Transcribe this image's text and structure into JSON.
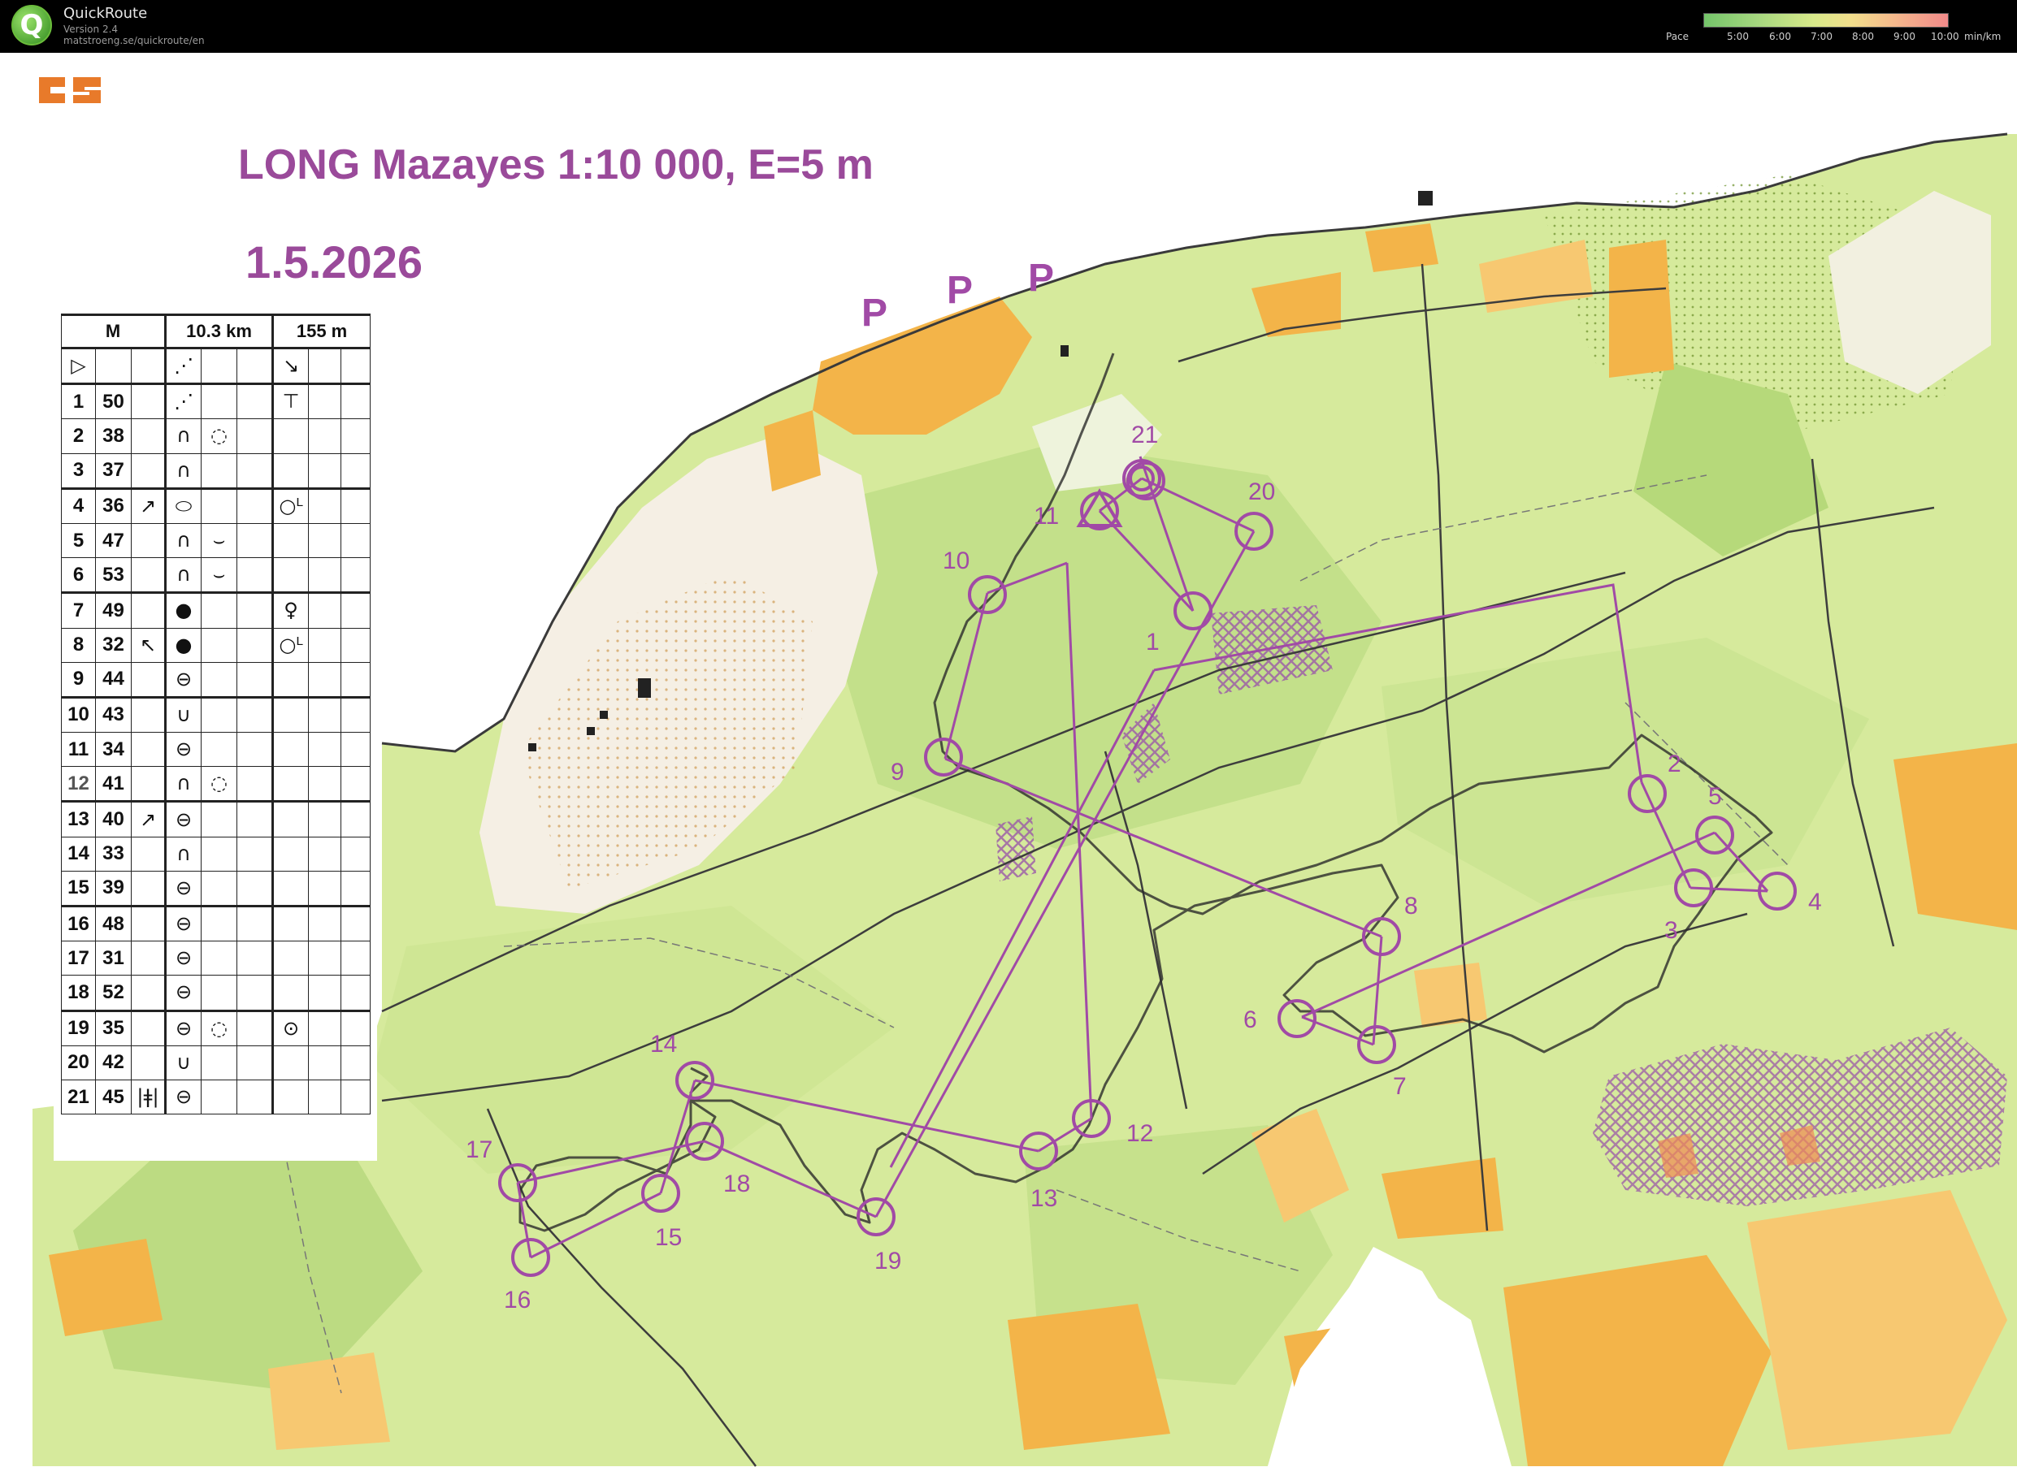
{
  "app": {
    "name": "QuickRoute",
    "version": "Version 2.4",
    "url": "matstroeng.se/quickroute/en",
    "logo_letter": "Q"
  },
  "pace_legend": {
    "label": "Pace",
    "ticks": [
      "5:00",
      "6:00",
      "7:00",
      "8:00",
      "9:00",
      "10:00",
      "min/km"
    ]
  },
  "map": {
    "title": "LONG Mazayes 1:10 000, E=5 m",
    "date": "1.5.2026",
    "parking_label": "P",
    "course_color": "#a14aa6",
    "route_color": "#2b2b2b"
  },
  "description_sheet": {
    "class": "M",
    "length": "10.3 km",
    "climb": "155 m",
    "controls": [
      {
        "num": "1",
        "code": "50"
      },
      {
        "num": "2",
        "code": "38"
      },
      {
        "num": "3",
        "code": "37"
      },
      {
        "num": "4",
        "code": "36"
      },
      {
        "num": "5",
        "code": "47"
      },
      {
        "num": "6",
        "code": "53"
      },
      {
        "num": "7",
        "code": "49"
      },
      {
        "num": "8",
        "code": "32"
      },
      {
        "num": "9",
        "code": "44"
      },
      {
        "num": "10",
        "code": "43"
      },
      {
        "num": "11",
        "code": "34"
      },
      {
        "num": "12",
        "code": "41"
      },
      {
        "num": "13",
        "code": "40"
      },
      {
        "num": "14",
        "code": "33"
      },
      {
        "num": "15",
        "code": "39"
      },
      {
        "num": "16",
        "code": "48"
      },
      {
        "num": "17",
        "code": "31"
      },
      {
        "num": "18",
        "code": "52"
      },
      {
        "num": "19",
        "code": "35"
      },
      {
        "num": "20",
        "code": "42"
      },
      {
        "num": "21",
        "code": "45"
      }
    ]
  },
  "course_controls": [
    {
      "label": "1"
    },
    {
      "label": "2"
    },
    {
      "label": "3"
    },
    {
      "label": "4"
    },
    {
      "label": "5"
    },
    {
      "label": "6"
    },
    {
      "label": "7"
    },
    {
      "label": "8"
    },
    {
      "label": "9"
    },
    {
      "label": "10"
    },
    {
      "label": "11"
    },
    {
      "label": "12"
    },
    {
      "label": "13"
    },
    {
      "label": "14"
    },
    {
      "label": "15"
    },
    {
      "label": "16"
    },
    {
      "label": "17"
    },
    {
      "label": "18"
    },
    {
      "label": "19"
    },
    {
      "label": "20"
    },
    {
      "label": "21"
    }
  ]
}
